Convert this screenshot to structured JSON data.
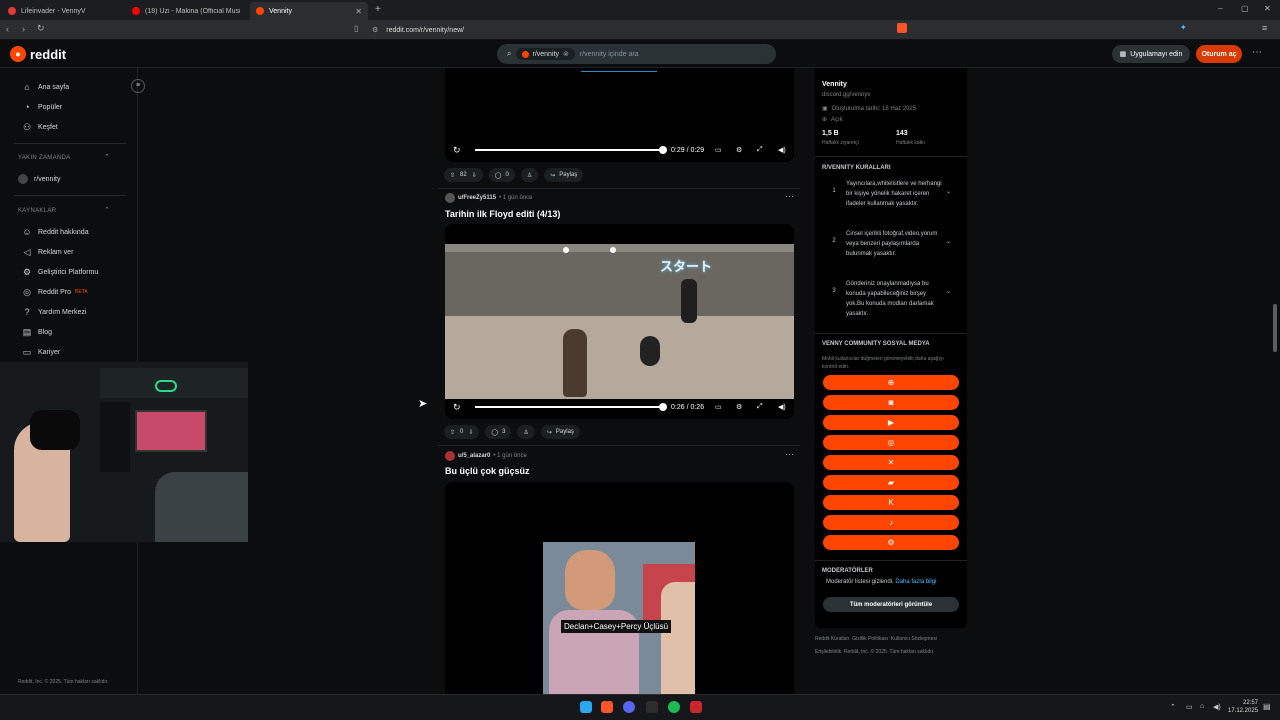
{
  "browser": {
    "tabs": [
      {
        "title": "Lifeinvader - VennyV",
        "color": "#e53935"
      },
      {
        "title": "(18) Uzi - Makina (Official Music Vide",
        "color": "#ff0000"
      },
      {
        "title": "Vennity",
        "color": "#ff4500"
      }
    ],
    "url": "reddit.com/r/vennity/new/"
  },
  "header": {
    "logo": "reddit",
    "search_chip": "r/vennity",
    "search_placeholder": "r/vennity içinde ara",
    "app_button": "Uygulamayı edin",
    "login_button": "Oturum aç"
  },
  "sidebar": {
    "nav": [
      "Ana sayfa",
      "Popüler",
      "Keşfet"
    ],
    "recent_heading": "YAKIN ZAMANDA",
    "recent": [
      "r/vennity"
    ],
    "resources_heading": "KAYNAKLAR",
    "resources": [
      "Reddit hakkında",
      "Reklam ver",
      "Geliştirici Platformu",
      "Reddit Pro",
      "Yardım Merkezi",
      "Blog",
      "Kariyer"
    ],
    "pro_badge": "BETA",
    "footer": "Reddit, Inc. © 2025. Tüm hakları saklıdır."
  },
  "posts": [
    {
      "time": "0:29 / 0:29",
      "votes": "82",
      "comments": "0",
      "share": "Paylaş"
    },
    {
      "author": "u/FreeZy5115",
      "age": "• 1 gün önce",
      "title": "Tarihin ilk Floyd editi (4/13)",
      "time": "0:26 / 0:26",
      "votes": "0",
      "comments": "3",
      "share": "Paylaş",
      "video_overlay": "スタート"
    },
    {
      "author": "u/5_alazar0",
      "age": "• 1 gün önce",
      "title": "Bu üçlü çok güçsüz",
      "caption": "Declan+Casey+Percy Üçlüsü"
    }
  ],
  "community": {
    "name": "Vennity",
    "link": "discord.gg/vennyv",
    "created": "Oluşturulma tarihi: 18 Haz 2025",
    "status": "Açık",
    "weekly_visitors_value": "1,5 B",
    "weekly_visitors_label": "Haftalık ziyaretçi",
    "weekly_contrib_value": "143",
    "weekly_contrib_label": "Haftalık katkı",
    "rules_heading": "R/VENNITY KURALLARI",
    "rules": [
      "Yayıncılara,whitelistlere ve herhangi bir kişiye yönelik hakaret içeren ifadeler kullanmak yasaktır.",
      "Cinsel içerikli fotoğraf,video,yorum veya benzeri paylaşımlarda bulunmak yasaktır.",
      "Gönderiniz onaylanmadıysa bu konuda yapabileceğiniz birşey yok.Bu konuda modları darlamak yasaktır."
    ],
    "social_heading": "VENNY COMMUNITY SOSYAL MEDYA",
    "social_note": "Mobil kullanıcılar düğmeleri göremeyebilir,daha aşağıyı kontrol edin.",
    "social_icons": [
      "globe-icon",
      "discord-icon",
      "youtube-icon",
      "instagram-icon",
      "x-icon",
      "twitch-icon",
      "kick-icon",
      "tiktok-icon",
      "steam-icon"
    ],
    "moderators_heading": "MODERATÖRLER",
    "moderators_note": "Moderatör listesi gizlendi.",
    "moderators_more": "Daha fazla bilgi",
    "moderators_button": "Tüm moderatörleri görüntüle"
  },
  "footer_links": {
    "line1": "Reddit Kuralları  Gizlilik Politikası  Kullanıcı Sözleşmesi",
    "line2": "Erişilebilirlik  Reddit, Inc. © 2025. Tüm hakları saklıdır."
  },
  "taskbar": {
    "time": "22:57",
    "date": "17.12.2025"
  },
  "colors": {
    "accent": "#ff4500",
    "login": "#d93a00",
    "link": "#4fbcff"
  }
}
